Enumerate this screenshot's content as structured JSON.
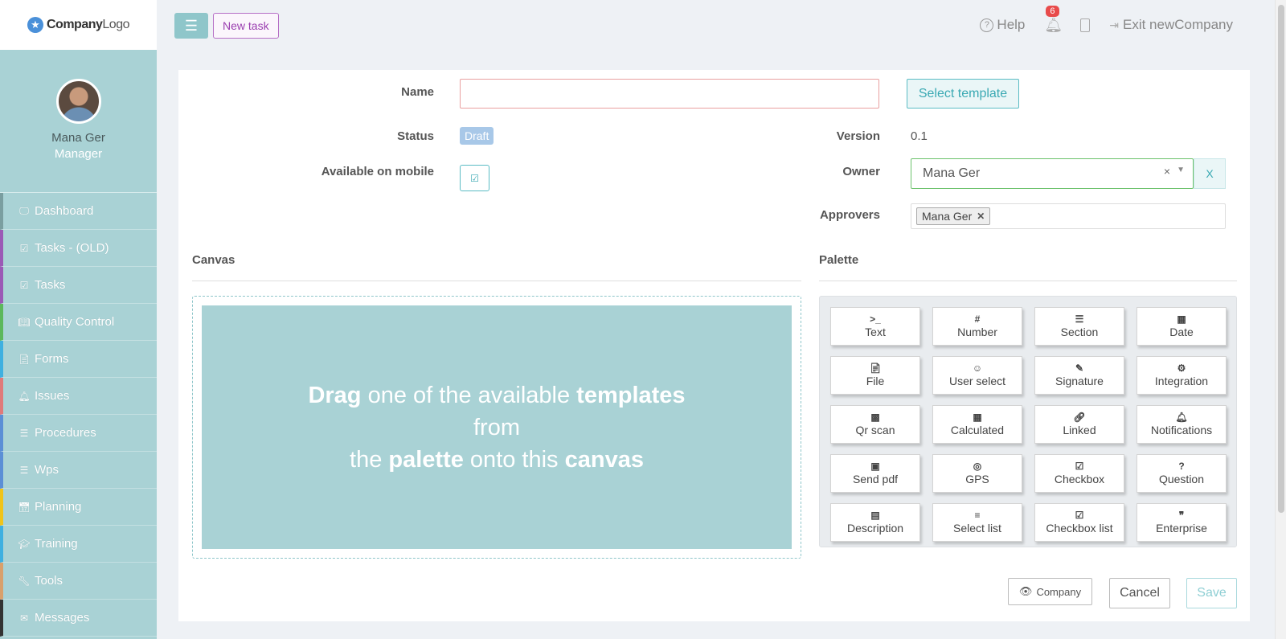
{
  "brand": {
    "logo_bold": "Company",
    "logo_light": "Logo",
    "logo_icon": "star-icon"
  },
  "profile": {
    "name": "Mana Ger",
    "role": "Manager"
  },
  "sidebar": {
    "items": [
      {
        "label": "Dashboard",
        "icon": "desktop-icon",
        "accent": "#7a9ea0"
      },
      {
        "label": "Tasks - (OLD)",
        "icon": "check-square-icon",
        "accent": "#9b59b6"
      },
      {
        "label": "Tasks",
        "icon": "check-square-icon",
        "accent": "#9b59b6"
      },
      {
        "label": "Quality Control",
        "icon": "book-icon",
        "accent": "#5cb85c"
      },
      {
        "label": "Forms",
        "icon": "file-icon",
        "accent": "#3fb0e0"
      },
      {
        "label": "Issues",
        "icon": "bell-icon",
        "accent": "#e07a7a"
      },
      {
        "label": "Procedures",
        "icon": "list-icon",
        "accent": "#5b8fd6"
      },
      {
        "label": "Wps",
        "icon": "list-icon",
        "accent": "#5b8fd6"
      },
      {
        "label": "Planning",
        "icon": "calendar-check-icon",
        "accent": "#f0c419"
      },
      {
        "label": "Training",
        "icon": "graduation-cap-icon",
        "accent": "#3fb0e0"
      },
      {
        "label": "Tools",
        "icon": "wrench-icon",
        "accent": "#d9a06b"
      },
      {
        "label": "Messages",
        "icon": "envelope-icon",
        "accent": "#333333"
      }
    ]
  },
  "topbar": {
    "new_task": "New task",
    "help": "Help",
    "notifications_count": "6",
    "exit_label": "Exit newCompany"
  },
  "form": {
    "name_label": "Name",
    "name_value": "",
    "select_template": "Select template",
    "status_label": "Status",
    "status_value": "Draft",
    "version_label": "Version",
    "version_value": "0.1",
    "mobile_label": "Available on mobile",
    "mobile_checked": true,
    "owner_label": "Owner",
    "owner_value": "Mana Ger",
    "owner_clear": "×",
    "owner_x": "X",
    "approvers_label": "Approvers",
    "approvers": [
      "Mana Ger"
    ]
  },
  "canvas": {
    "title": "Canvas",
    "drop_text_1a": "Drag",
    "drop_text_1b": " one of the available ",
    "drop_text_1c": "templates",
    "drop_text_2": "from",
    "drop_text_3a": "the ",
    "drop_text_3b": "palette",
    "drop_text_3c": " onto this ",
    "drop_text_3d": "canvas"
  },
  "palette": {
    "title": "Palette",
    "items": [
      {
        "label": "Text",
        "icon": "terminal-icon"
      },
      {
        "label": "Number",
        "icon": "hash-icon"
      },
      {
        "label": "Section",
        "icon": "section-icon"
      },
      {
        "label": "Date",
        "icon": "calendar-icon"
      },
      {
        "label": "File",
        "icon": "file-icon"
      },
      {
        "label": "User select",
        "icon": "user-circle-icon"
      },
      {
        "label": "Signature",
        "icon": "pen-square-icon"
      },
      {
        "label": "Integration",
        "icon": "cogs-icon"
      },
      {
        "label": "Qr scan",
        "icon": "qrcode-icon"
      },
      {
        "label": "Calculated",
        "icon": "calculator-icon"
      },
      {
        "label": "Linked",
        "icon": "link-icon"
      },
      {
        "label": "Notifications",
        "icon": "bell-icon"
      },
      {
        "label": "Send pdf",
        "icon": "image-icon"
      },
      {
        "label": "GPS",
        "icon": "compass-icon"
      },
      {
        "label": "Checkbox",
        "icon": "check-square-icon"
      },
      {
        "label": "Question",
        "icon": "question-circle-icon"
      },
      {
        "label": "Description",
        "icon": "file-text-icon"
      },
      {
        "label": "Select list",
        "icon": "list-ol-icon"
      },
      {
        "label": "Checkbox list",
        "icon": "check-square-icon"
      },
      {
        "label": "Enterprise",
        "icon": "quote-icon"
      }
    ]
  },
  "footer": {
    "company_btn": "Company",
    "cancel_btn": "Cancel",
    "save_btn": "Save"
  }
}
